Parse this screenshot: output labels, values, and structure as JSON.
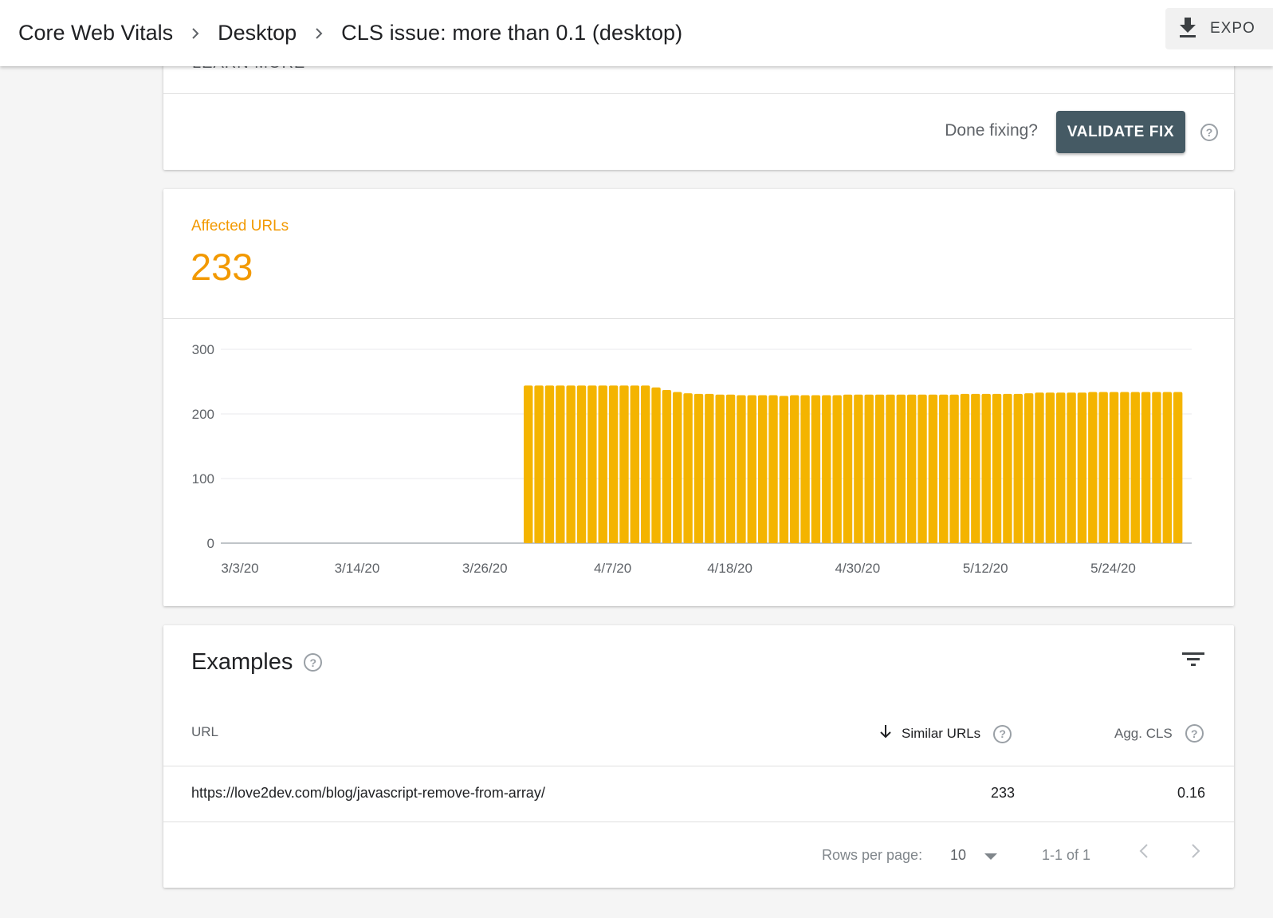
{
  "breadcrumb": {
    "items": [
      "Core Web Vitals",
      "Desktop",
      "CLS issue: more than 0.1 (desktop)"
    ]
  },
  "header": {
    "export_label": "EXPO",
    "export_icon": "download-icon"
  },
  "issue_card": {
    "learn_more": "LEARN MORE",
    "done_fixing": "Done fixing?",
    "validate_label": "VALIDATE FIX",
    "help_icon": "?"
  },
  "affected": {
    "label": "Affected URLs",
    "count": "233",
    "color": "#f29900"
  },
  "chart_data": {
    "type": "bar",
    "title": "Affected URLs",
    "xlabel": "",
    "ylabel": "",
    "ylim": [
      0,
      300
    ],
    "yticks": [
      "0",
      "100",
      "200",
      "300"
    ],
    "ytick_values": [
      0,
      100,
      200,
      300
    ],
    "xtick_labels": [
      "3/3/20",
      "3/14/20",
      "3/26/20",
      "4/7/20",
      "4/18/20",
      "4/30/20",
      "5/12/20",
      "5/24/20"
    ],
    "xtick_day_index": [
      0,
      11,
      23,
      35,
      46,
      58,
      70,
      82
    ],
    "start_date": "3/3/20",
    "first_bar_day_index": 27,
    "grid": true,
    "bar_color": "#f4b400",
    "values": [
      244,
      244,
      244,
      244,
      244,
      244,
      244,
      244,
      244,
      244,
      244,
      244,
      241,
      237,
      234,
      232,
      231,
      231,
      230,
      230,
      229,
      229,
      229,
      229,
      228,
      229,
      229,
      229,
      229,
      229,
      230,
      230,
      230,
      230,
      230,
      230,
      230,
      230,
      230,
      230,
      230,
      231,
      231,
      231,
      231,
      231,
      231,
      232,
      233,
      233,
      233,
      233,
      233,
      234,
      234,
      234,
      234,
      234,
      234,
      234,
      234,
      234
    ]
  },
  "examples": {
    "title": "Examples",
    "columns": {
      "url": "URL",
      "similar": "Similar URLs",
      "agg": "Agg. CLS"
    },
    "rows": [
      {
        "url": "https://love2dev.com/blog/javascript-remove-from-array/",
        "similar": "233",
        "agg": "0.16"
      }
    ],
    "pagination": {
      "rows_per_page_label": "Rows per page:",
      "rows_per_page": "10",
      "range": "1-1 of 1"
    }
  }
}
